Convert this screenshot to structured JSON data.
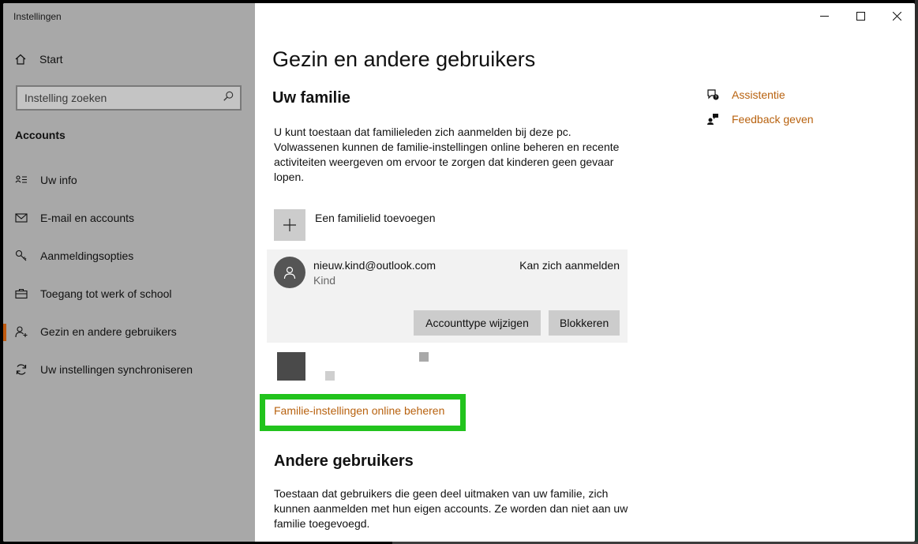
{
  "window": {
    "title": "Instellingen"
  },
  "sidebar": {
    "home_label": "Start",
    "search_placeholder": "Instelling zoeken",
    "section_title": "Accounts",
    "items": [
      {
        "label": "Uw info",
        "icon": "user-card-icon"
      },
      {
        "label": "E-mail en accounts",
        "icon": "mail-icon"
      },
      {
        "label": "Aanmeldingsopties",
        "icon": "key-icon"
      },
      {
        "label": "Toegang tot werk of school",
        "icon": "briefcase-icon"
      },
      {
        "label": "Gezin en andere gebruikers",
        "icon": "add-person-icon",
        "active": true
      },
      {
        "label": "Uw instellingen synchroniseren",
        "icon": "sync-icon"
      }
    ]
  },
  "main": {
    "page_title": "Gezin en andere gebruikers",
    "family_title": "Uw familie",
    "family_desc": "U kunt toestaan dat familieleden zich aanmelden bij deze pc. Volwassenen kunnen de familie-instellingen online beheren en recente activiteiten weergeven om ervoor te zorgen dat kinderen geen gevaar lopen.",
    "add_member_label": "Een familielid toevoegen",
    "member": {
      "email": "nieuw.kind@outlook.com",
      "role": "Kind",
      "status": "Kan zich aanmelden",
      "change_button": "Accounttype wijzigen",
      "block_button": "Blokkeren"
    },
    "family_link": "Familie-instellingen online beheren",
    "other_title": "Andere gebruikers",
    "other_desc": "Toestaan dat gebruikers die geen deel uitmaken van uw familie, zich kunnen aanmelden met hun eigen accounts. Ze worden dan niet aan uw familie toegevoegd."
  },
  "side_links": {
    "help": "Assistentie",
    "feedback": "Feedback geven"
  },
  "colors": {
    "accent": "#b8620f",
    "highlight": "#22c31d",
    "sidebar_bg": "#a8a8a8"
  }
}
